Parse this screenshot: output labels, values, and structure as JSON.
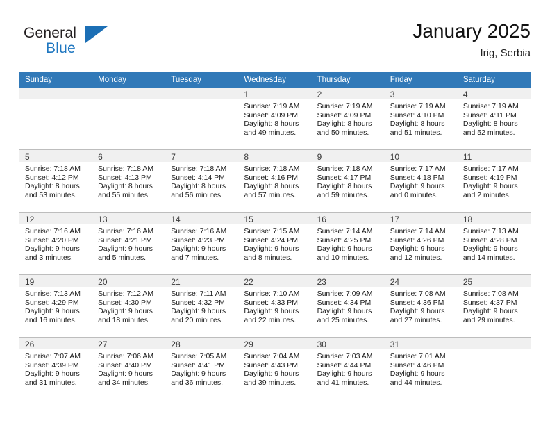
{
  "brand": {
    "name_part1": "General",
    "name_part2": "Blue",
    "flag_icon": "flag-triangle-icon",
    "accent_color": "#1c6fb5"
  },
  "header": {
    "title": "January 2025",
    "subtitle": "Irig, Serbia"
  },
  "calendar": {
    "header_bg": "#3179b8",
    "daynum_bg": "#f0f0f0",
    "weekday_headers": [
      "Sunday",
      "Monday",
      "Tuesday",
      "Wednesday",
      "Thursday",
      "Friday",
      "Saturday"
    ],
    "weeks": [
      [
        {
          "day": "",
          "lines": []
        },
        {
          "day": "",
          "lines": []
        },
        {
          "day": "",
          "lines": []
        },
        {
          "day": "1",
          "lines": [
            "Sunrise: 7:19 AM",
            "Sunset: 4:09 PM",
            "Daylight: 8 hours",
            "and 49 minutes."
          ]
        },
        {
          "day": "2",
          "lines": [
            "Sunrise: 7:19 AM",
            "Sunset: 4:09 PM",
            "Daylight: 8 hours",
            "and 50 minutes."
          ]
        },
        {
          "day": "3",
          "lines": [
            "Sunrise: 7:19 AM",
            "Sunset: 4:10 PM",
            "Daylight: 8 hours",
            "and 51 minutes."
          ]
        },
        {
          "day": "4",
          "lines": [
            "Sunrise: 7:19 AM",
            "Sunset: 4:11 PM",
            "Daylight: 8 hours",
            "and 52 minutes."
          ]
        }
      ],
      [
        {
          "day": "5",
          "lines": [
            "Sunrise: 7:18 AM",
            "Sunset: 4:12 PM",
            "Daylight: 8 hours",
            "and 53 minutes."
          ]
        },
        {
          "day": "6",
          "lines": [
            "Sunrise: 7:18 AM",
            "Sunset: 4:13 PM",
            "Daylight: 8 hours",
            "and 55 minutes."
          ]
        },
        {
          "day": "7",
          "lines": [
            "Sunrise: 7:18 AM",
            "Sunset: 4:14 PM",
            "Daylight: 8 hours",
            "and 56 minutes."
          ]
        },
        {
          "day": "8",
          "lines": [
            "Sunrise: 7:18 AM",
            "Sunset: 4:16 PM",
            "Daylight: 8 hours",
            "and 57 minutes."
          ]
        },
        {
          "day": "9",
          "lines": [
            "Sunrise: 7:18 AM",
            "Sunset: 4:17 PM",
            "Daylight: 8 hours",
            "and 59 minutes."
          ]
        },
        {
          "day": "10",
          "lines": [
            "Sunrise: 7:17 AM",
            "Sunset: 4:18 PM",
            "Daylight: 9 hours",
            "and 0 minutes."
          ]
        },
        {
          "day": "11",
          "lines": [
            "Sunrise: 7:17 AM",
            "Sunset: 4:19 PM",
            "Daylight: 9 hours",
            "and 2 minutes."
          ]
        }
      ],
      [
        {
          "day": "12",
          "lines": [
            "Sunrise: 7:16 AM",
            "Sunset: 4:20 PM",
            "Daylight: 9 hours",
            "and 3 minutes."
          ]
        },
        {
          "day": "13",
          "lines": [
            "Sunrise: 7:16 AM",
            "Sunset: 4:21 PM",
            "Daylight: 9 hours",
            "and 5 minutes."
          ]
        },
        {
          "day": "14",
          "lines": [
            "Sunrise: 7:16 AM",
            "Sunset: 4:23 PM",
            "Daylight: 9 hours",
            "and 7 minutes."
          ]
        },
        {
          "day": "15",
          "lines": [
            "Sunrise: 7:15 AM",
            "Sunset: 4:24 PM",
            "Daylight: 9 hours",
            "and 8 minutes."
          ]
        },
        {
          "day": "16",
          "lines": [
            "Sunrise: 7:14 AM",
            "Sunset: 4:25 PM",
            "Daylight: 9 hours",
            "and 10 minutes."
          ]
        },
        {
          "day": "17",
          "lines": [
            "Sunrise: 7:14 AM",
            "Sunset: 4:26 PM",
            "Daylight: 9 hours",
            "and 12 minutes."
          ]
        },
        {
          "day": "18",
          "lines": [
            "Sunrise: 7:13 AM",
            "Sunset: 4:28 PM",
            "Daylight: 9 hours",
            "and 14 minutes."
          ]
        }
      ],
      [
        {
          "day": "19",
          "lines": [
            "Sunrise: 7:13 AM",
            "Sunset: 4:29 PM",
            "Daylight: 9 hours",
            "and 16 minutes."
          ]
        },
        {
          "day": "20",
          "lines": [
            "Sunrise: 7:12 AM",
            "Sunset: 4:30 PM",
            "Daylight: 9 hours",
            "and 18 minutes."
          ]
        },
        {
          "day": "21",
          "lines": [
            "Sunrise: 7:11 AM",
            "Sunset: 4:32 PM",
            "Daylight: 9 hours",
            "and 20 minutes."
          ]
        },
        {
          "day": "22",
          "lines": [
            "Sunrise: 7:10 AM",
            "Sunset: 4:33 PM",
            "Daylight: 9 hours",
            "and 22 minutes."
          ]
        },
        {
          "day": "23",
          "lines": [
            "Sunrise: 7:09 AM",
            "Sunset: 4:34 PM",
            "Daylight: 9 hours",
            "and 25 minutes."
          ]
        },
        {
          "day": "24",
          "lines": [
            "Sunrise: 7:08 AM",
            "Sunset: 4:36 PM",
            "Daylight: 9 hours",
            "and 27 minutes."
          ]
        },
        {
          "day": "25",
          "lines": [
            "Sunrise: 7:08 AM",
            "Sunset: 4:37 PM",
            "Daylight: 9 hours",
            "and 29 minutes."
          ]
        }
      ],
      [
        {
          "day": "26",
          "lines": [
            "Sunrise: 7:07 AM",
            "Sunset: 4:39 PM",
            "Daylight: 9 hours",
            "and 31 minutes."
          ]
        },
        {
          "day": "27",
          "lines": [
            "Sunrise: 7:06 AM",
            "Sunset: 4:40 PM",
            "Daylight: 9 hours",
            "and 34 minutes."
          ]
        },
        {
          "day": "28",
          "lines": [
            "Sunrise: 7:05 AM",
            "Sunset: 4:41 PM",
            "Daylight: 9 hours",
            "and 36 minutes."
          ]
        },
        {
          "day": "29",
          "lines": [
            "Sunrise: 7:04 AM",
            "Sunset: 4:43 PM",
            "Daylight: 9 hours",
            "and 39 minutes."
          ]
        },
        {
          "day": "30",
          "lines": [
            "Sunrise: 7:03 AM",
            "Sunset: 4:44 PM",
            "Daylight: 9 hours",
            "and 41 minutes."
          ]
        },
        {
          "day": "31",
          "lines": [
            "Sunrise: 7:01 AM",
            "Sunset: 4:46 PM",
            "Daylight: 9 hours",
            "and 44 minutes."
          ]
        },
        {
          "day": "",
          "lines": []
        }
      ]
    ]
  }
}
